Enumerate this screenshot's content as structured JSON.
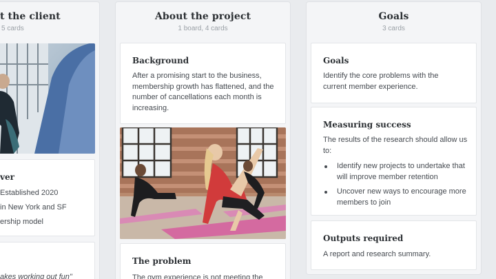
{
  "columns": {
    "client": {
      "title": "t the client",
      "subtitle": "5 cards",
      "overview_title": "ver",
      "overview_lines": [
        "Established 2020",
        "in New York and SF",
        "ership model"
      ],
      "quote": "akes working out fun\""
    },
    "project": {
      "title": "About the project",
      "subtitle": "1 board, 4 cards",
      "background": {
        "title": "Background",
        "text": "After a promising start to the business, membership growth has flattened, and the number of cancellations each month is increasing."
      },
      "problem": {
        "title": "The problem",
        "text": "The gym experience is not meeting the"
      }
    },
    "goals": {
      "title": "Goals",
      "subtitle": "3 cards",
      "goals_card": {
        "title": "Goals",
        "text": "Identify the core problems with the current member experience."
      },
      "success_card": {
        "title": "Measuring success",
        "text": "The results of the research should allow us to:",
        "bullets": [
          "Identify new projects to undertake that will improve member retention",
          "Uncover new ways to encourage more members to join"
        ]
      },
      "outputs_card": {
        "title": "Outputs required",
        "text": "A report and research summary."
      }
    }
  },
  "colors": {
    "background": "#e9ebee",
    "card": "#ffffff",
    "column": "#f4f5f7",
    "title": "#2b2f33",
    "muted": "#9aa0a6"
  },
  "icons": {
    "bullet": "disc"
  }
}
